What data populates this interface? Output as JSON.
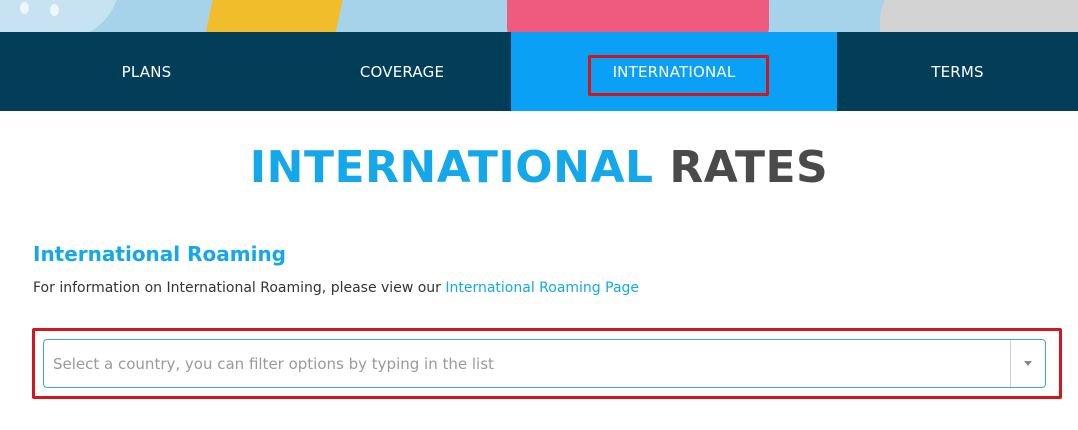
{
  "nav": {
    "items": [
      {
        "label": "PLANS"
      },
      {
        "label": "COVERAGE"
      },
      {
        "label": "INTERNATIONAL",
        "active": true
      },
      {
        "label": "TERMS"
      }
    ]
  },
  "page": {
    "title_part1": "INTERNATIONAL",
    "title_part2": "RATES"
  },
  "roaming": {
    "heading": "International Roaming",
    "info_text": "For information on International Roaming, please view our ",
    "link_label": "International Roaming Page"
  },
  "country_select": {
    "placeholder": "Select a country, you can filter options by typing in the list"
  },
  "colors": {
    "nav_bg": "#033e58",
    "nav_active": "#0aa0f5",
    "accent": "#14a8ea",
    "highlight": "#d1161c"
  }
}
